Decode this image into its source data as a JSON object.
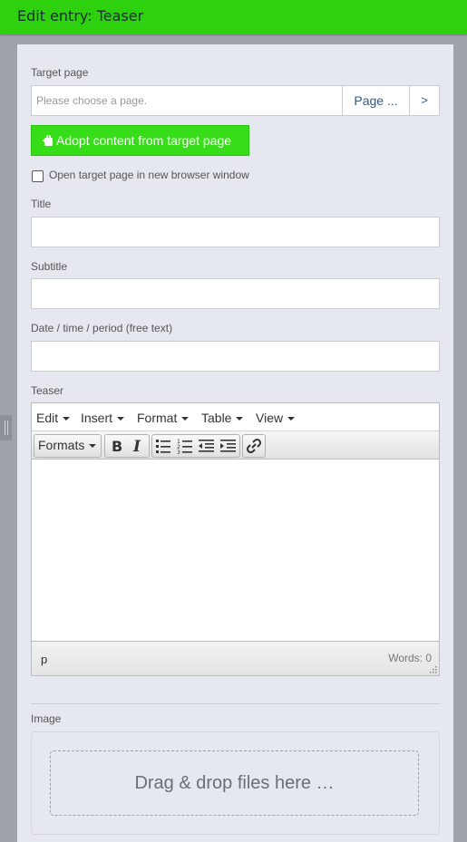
{
  "header": {
    "title": "Edit entry: Teaser"
  },
  "form": {
    "target_page": {
      "label": "Target page",
      "placeholder": "Please choose a page.",
      "page_button": "Page ...",
      "next_button": ">"
    },
    "adopt_button": "Adopt content from target page",
    "open_new_window": {
      "label": "Open target page in new browser window",
      "checked": false
    },
    "title": {
      "label": "Title",
      "value": ""
    },
    "subtitle": {
      "label": "Subtitle",
      "value": ""
    },
    "date": {
      "label": "Date / time / period (free text)",
      "value": ""
    },
    "teaser": {
      "label": "Teaser",
      "menu": [
        "Edit",
        "Insert",
        "Format",
        "Table",
        "View"
      ],
      "toolbar": {
        "formats": "Formats",
        "buttons": [
          "bold-icon",
          "italic-icon",
          "bullet-list-icon",
          "numbered-list-icon",
          "outdent-icon",
          "indent-icon",
          "link-icon"
        ]
      },
      "content": "",
      "status_path": "p",
      "word_count": "Words: 0"
    },
    "image": {
      "label": "Image",
      "dropzone": "Drag & drop files here …"
    }
  },
  "colors": {
    "header_bg": "#2ed10d",
    "adopt_button_bg": "#38dd1a",
    "panel_bg": "#e6e8ef",
    "page_bg": "#9fa3ab"
  }
}
